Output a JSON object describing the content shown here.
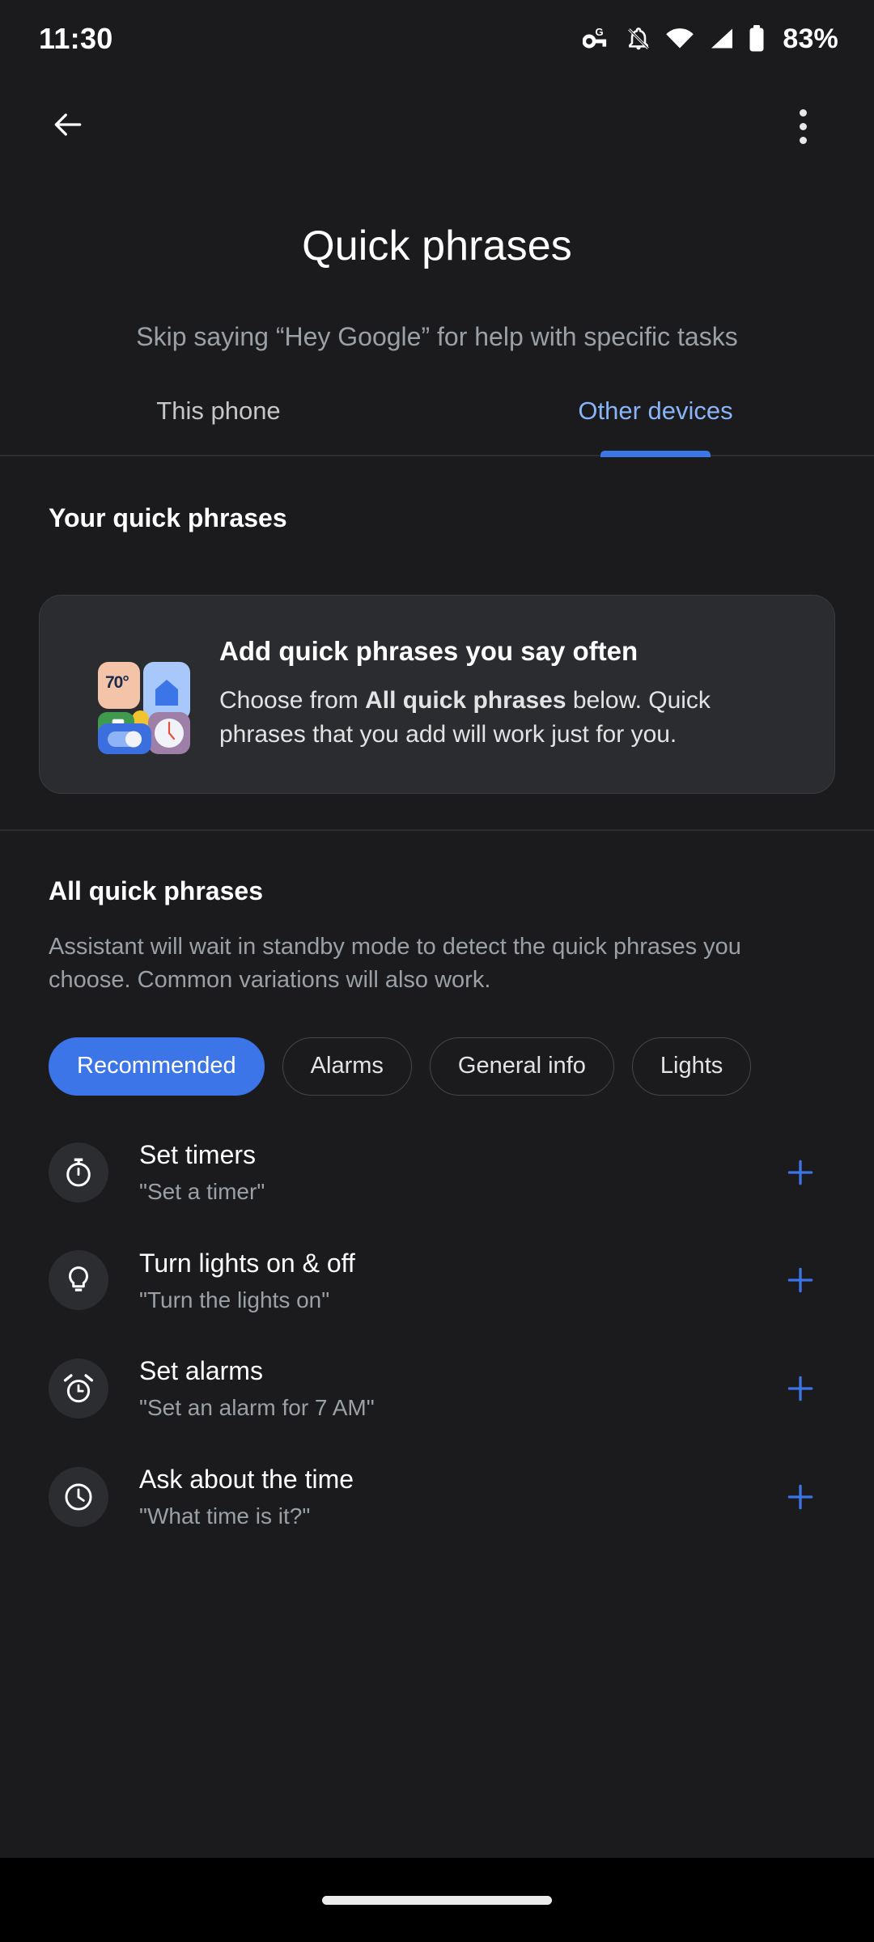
{
  "status_bar": {
    "time": "11:30",
    "battery_percent": "83%",
    "icons": [
      "password-key-google-icon",
      "notifications-off-icon",
      "wifi-icon",
      "cellular-signal-icon",
      "battery-icon"
    ]
  },
  "app_bar": {
    "back_icon": "back-arrow-icon",
    "overflow_icon": "more-vert-icon"
  },
  "header": {
    "title": "Quick phrases",
    "subtitle": "Skip saying “Hey Google” for help with specific tasks"
  },
  "tabs": [
    {
      "label": "This phone",
      "active": false
    },
    {
      "label": "Other devices",
      "active": true
    }
  ],
  "your_phrases": {
    "section_title": "Your quick phrases",
    "card": {
      "heading": "Add quick phrases you say often",
      "body_before": "Choose from ",
      "body_bold": "All quick phrases",
      "body_after": " below. Quick phrases that you add will work just for you.",
      "illustration": {
        "name": "smart-home-tiles-illustration",
        "weather_temp": "70°"
      }
    }
  },
  "all_phrases": {
    "section_title": "All quick phrases",
    "description": "Assistant will wait in standby mode to detect the quick phrases you choose. Common variations will also work.",
    "chips": [
      {
        "label": "Recommended",
        "active": true
      },
      {
        "label": "Alarms",
        "active": false
      },
      {
        "label": "General info",
        "active": false
      },
      {
        "label": "Lights",
        "active": false
      }
    ],
    "items": [
      {
        "title": "Set timers",
        "example": "\"Set a timer\"",
        "icon": "timer-icon",
        "add_label": "+"
      },
      {
        "title": "Turn lights on & off",
        "example": "\"Turn the lights on\"",
        "icon": "lightbulb-icon",
        "add_label": "+"
      },
      {
        "title": "Set alarms",
        "example": "\"Set an alarm for 7 AM\"",
        "icon": "alarm-icon",
        "add_label": "+"
      },
      {
        "title": "Ask about the time",
        "example": "\"What time is it?\"",
        "icon": "clock-icon",
        "add_label": "+"
      }
    ]
  },
  "gesture_bar": {
    "handle": "home-gesture-handle"
  },
  "colors": {
    "background": "#1b1b1d",
    "card_background": "#2b2c2f",
    "accent_blue": "#3b75e8",
    "tab_active_text": "#8ab4f8",
    "primary_text": "#ffffff",
    "secondary_text": "#9aa0a6"
  }
}
